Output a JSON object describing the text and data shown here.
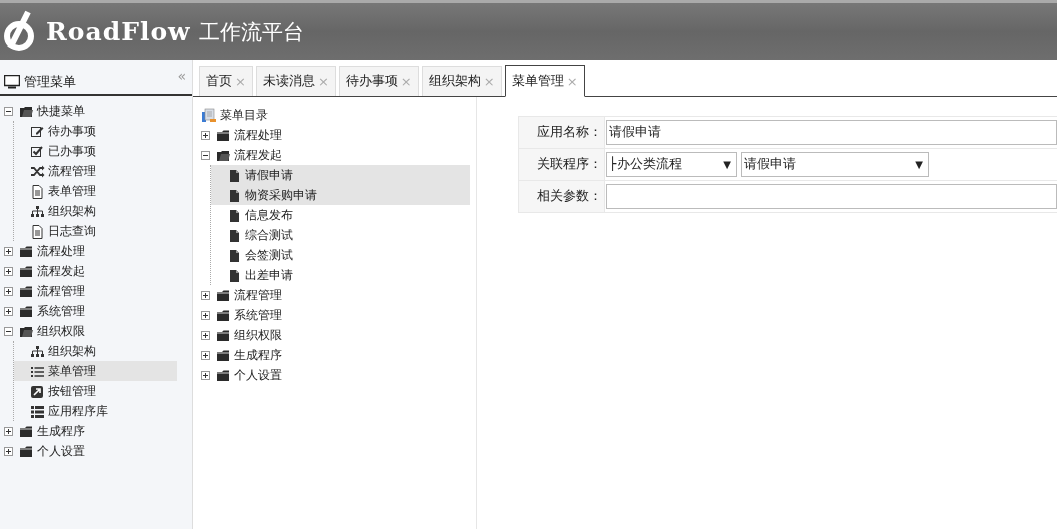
{
  "header": {
    "logo_text": "RoadFlow",
    "title": "工作流平台"
  },
  "sidebar": {
    "title": "管理菜单",
    "collapse": "«",
    "items": [
      {
        "label": "快捷菜单",
        "kind": "folder",
        "expanded": true,
        "selected": false,
        "children": [
          {
            "label": "待办事项",
            "kind": "edit",
            "selected": false
          },
          {
            "label": "已办事项",
            "kind": "check",
            "selected": false
          },
          {
            "label": "流程管理",
            "kind": "shuffle",
            "selected": false
          },
          {
            "label": "表单管理",
            "kind": "doc",
            "selected": false
          },
          {
            "label": "组织架构",
            "kind": "org",
            "selected": false
          },
          {
            "label": "日志查询",
            "kind": "doc",
            "selected": false
          }
        ]
      },
      {
        "label": "流程处理",
        "kind": "folder",
        "expanded": false,
        "selected": false
      },
      {
        "label": "流程发起",
        "kind": "folder",
        "expanded": false,
        "selected": false
      },
      {
        "label": "流程管理",
        "kind": "folder",
        "expanded": false,
        "selected": false
      },
      {
        "label": "系统管理",
        "kind": "folder",
        "expanded": false,
        "selected": false
      },
      {
        "label": "组织权限",
        "kind": "folder",
        "expanded": true,
        "selected": false,
        "children": [
          {
            "label": "组织架构",
            "kind": "org",
            "selected": false
          },
          {
            "label": "菜单管理",
            "kind": "list",
            "selected": true
          },
          {
            "label": "按钮管理",
            "kind": "external",
            "selected": false
          },
          {
            "label": "应用程序库",
            "kind": "biglist",
            "selected": false
          }
        ]
      },
      {
        "label": "生成程序",
        "kind": "folder",
        "expanded": false,
        "selected": false
      },
      {
        "label": "个人设置",
        "kind": "folder",
        "expanded": false,
        "selected": false
      }
    ]
  },
  "tabs": [
    {
      "label": "首页",
      "close": "×",
      "selected": false
    },
    {
      "label": "未读消息",
      "close": "×",
      "selected": false
    },
    {
      "label": "待办事项",
      "close": "×",
      "selected": false
    },
    {
      "label": "组织架构",
      "close": "×",
      "selected": false
    },
    {
      "label": "菜单管理",
      "close": "×",
      "selected": true
    }
  ],
  "menu_tree": {
    "root": "菜单目录",
    "items": [
      {
        "label": "流程处理",
        "kind": "folder",
        "expanded": false,
        "selected": false
      },
      {
        "label": "流程发起",
        "kind": "folder",
        "expanded": true,
        "selected": false,
        "children": [
          {
            "label": "请假申请",
            "kind": "file",
            "selected": true
          },
          {
            "label": "物资采购申请",
            "kind": "file",
            "selected": true
          },
          {
            "label": "信息发布",
            "kind": "file",
            "selected": false
          },
          {
            "label": "综合测试",
            "kind": "file",
            "selected": false
          },
          {
            "label": "会签测试",
            "kind": "file",
            "selected": false
          },
          {
            "label": "出差申请",
            "kind": "file",
            "selected": false
          }
        ]
      },
      {
        "label": "流程管理",
        "kind": "folder",
        "expanded": false,
        "selected": false
      },
      {
        "label": "系统管理",
        "kind": "folder",
        "expanded": false,
        "selected": false
      },
      {
        "label": "组织权限",
        "kind": "folder",
        "expanded": false,
        "selected": false
      },
      {
        "label": "生成程序",
        "kind": "folder",
        "expanded": false,
        "selected": false
      },
      {
        "label": "个人设置",
        "kind": "folder",
        "expanded": false,
        "selected": false
      }
    ]
  },
  "form": [
    {
      "label": "应用名称：",
      "kind": "text",
      "value": "请假申请"
    },
    {
      "label": "关联程序：",
      "kind": "selects",
      "selects": [
        {
          "value": "├办公类流程",
          "caret": "▼"
        },
        {
          "value": "请假申请",
          "caret": "▼"
        }
      ]
    },
    {
      "label": "相关参数：",
      "kind": "text"
    }
  ]
}
